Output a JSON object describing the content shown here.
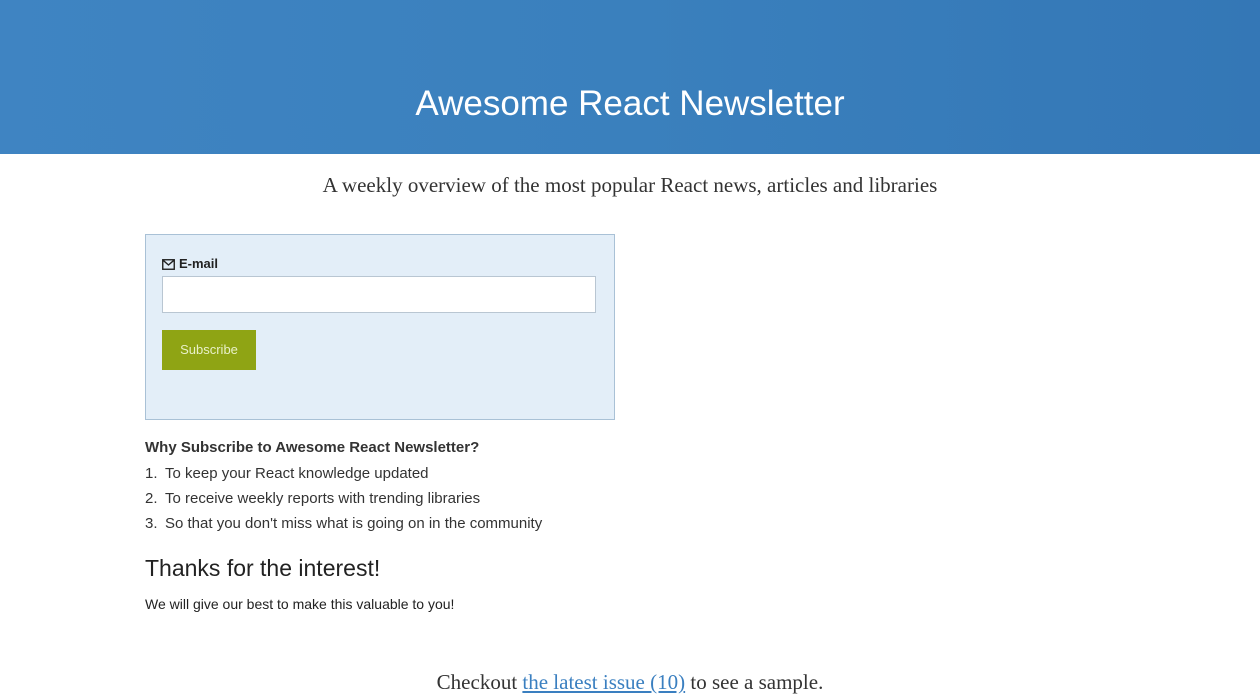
{
  "header": {
    "title": "Awesome React Newsletter",
    "background_color": "#3a80bd"
  },
  "tagline": "A weekly overview of the most popular React news, articles and libraries",
  "form": {
    "email_label": "E-mail",
    "email_icon": "envelope-icon",
    "email_value": "",
    "email_placeholder": "",
    "subscribe_label": "Subscribe",
    "subscribe_color": "#8fa414",
    "box_color": "#e3eef8"
  },
  "why": {
    "heading": "Why Subscribe to Awesome React Newsletter?",
    "items": [
      {
        "number": "1.",
        "text": "To keep your React knowledge updated"
      },
      {
        "number": "2.",
        "text": "To receive weekly reports with trending libraries"
      },
      {
        "number": "3.",
        "text": "So that you don't miss what is going on in the community"
      }
    ]
  },
  "thanks": {
    "heading": "Thanks for the interest!",
    "text": "We will give our best to make this valuable to you!"
  },
  "sample": {
    "prefix": "Checkout",
    "link_text": "the latest issue (10)",
    "suffix": "to see a sample.",
    "link_color": "#3a7fc0"
  }
}
